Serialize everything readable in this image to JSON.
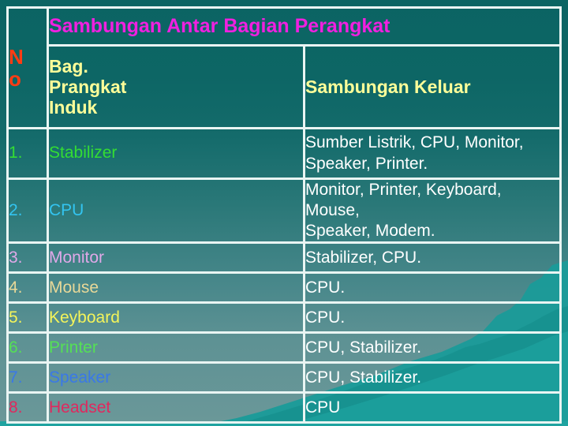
{
  "slide": {
    "title": "Sambungan Antar Bagian Perangkat",
    "no_header_lines": [
      "N",
      "o"
    ],
    "columns": {
      "no": "No",
      "bag_lines": [
        "Bag.",
        "Prangkat",
        "Induk"
      ],
      "keluar": "Sambungan Keluar"
    },
    "colors": {
      "title": "#f020e0",
      "no_header": "#ff3c14",
      "column_header": "#ffff99",
      "outgoing_text": "#ffffff",
      "border": "#e9f5f3",
      "background_top": "#0b6463",
      "background_bottom": "#6b9899",
      "decoration": "#1a9e9c"
    },
    "rows": [
      {
        "no": "1.",
        "name": "Stabilizer",
        "name_color": "#33dd33",
        "out": "Sumber Listrik, CPU, Monitor,\nSpeaker, Printer."
      },
      {
        "no": "2.",
        "name": "CPU",
        "name_color": "#33c4f0",
        "out": "Monitor, Printer, Keyboard, Mouse,\nSpeaker, Modem."
      },
      {
        "no": "3.",
        "name": "Monitor",
        "name_color": "#e0a8e8",
        "out": "Stabilizer, CPU."
      },
      {
        "no": "4.",
        "name": "Mouse",
        "name_color": "#e8d898",
        "out": "CPU."
      },
      {
        "no": "5.",
        "name": "Keyboard",
        "name_color": "#f4f45a",
        "out": "CPU."
      },
      {
        "no": "6.",
        "name": "Printer",
        "name_color": "#55e055",
        "out": "CPU, Stabilizer."
      },
      {
        "no": "7.",
        "name": "Speaker",
        "name_color": "#3a78e8",
        "out": "CPU, Stabilizer."
      },
      {
        "no": "8.",
        "name": "Headset",
        "name_color": "#e0285e",
        "out": "CPU"
      }
    ]
  }
}
